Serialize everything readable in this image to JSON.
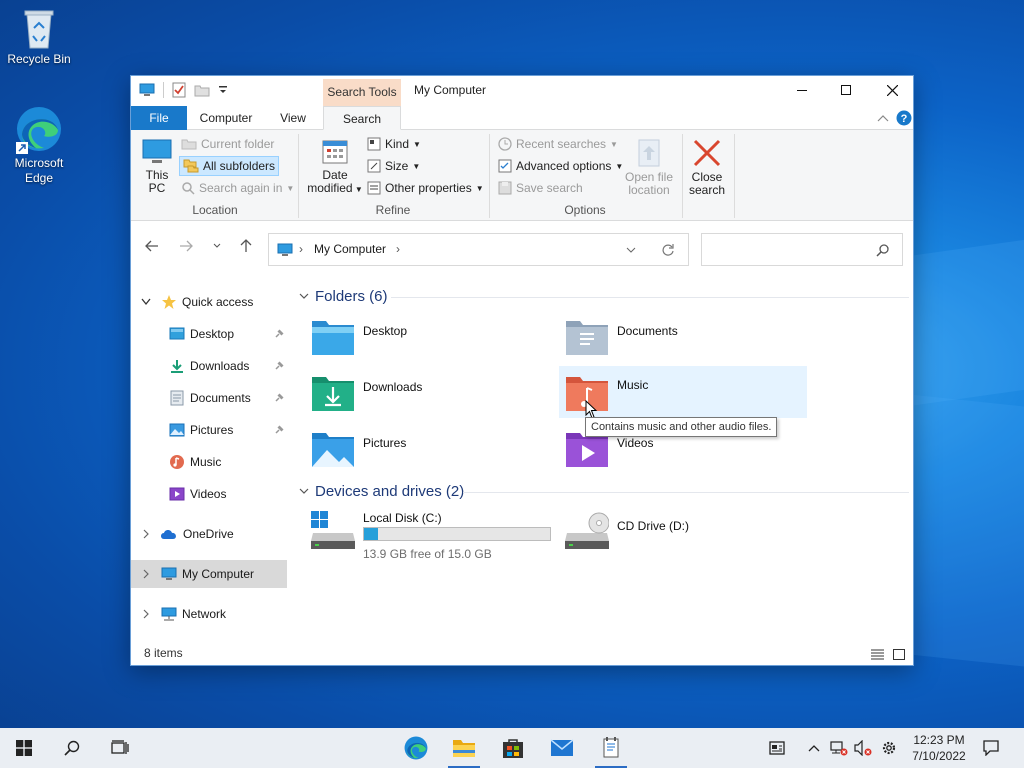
{
  "desktop": {
    "icons": [
      {
        "label": "Recycle Bin",
        "icon": "recycle-bin-icon"
      },
      {
        "label": "Microsoft Edge",
        "icon": "edge-icon"
      }
    ]
  },
  "window": {
    "title": "My Computer",
    "context_tab": "Search Tools",
    "tabs": [
      "File",
      "Computer",
      "View",
      "Search"
    ],
    "active_tab": "Search",
    "ribbon": {
      "location": {
        "label": "Location",
        "this_pc_1": "This",
        "this_pc_2": "PC",
        "current_folder": "Current folder",
        "all_subfolders": "All subfolders",
        "search_again_in": "Search again in"
      },
      "refine": {
        "label": "Refine",
        "date_modified_1": "Date",
        "date_modified_2": "modified",
        "kind": "Kind",
        "size": "Size",
        "other_properties": "Other properties"
      },
      "options": {
        "label": "Options",
        "recent_searches": "Recent searches",
        "advanced_options": "Advanced options",
        "save_search": "Save search",
        "open_file_location_1": "Open file",
        "open_file_location_2": "location"
      },
      "close": {
        "label_1": "Close",
        "label_2": "search"
      }
    },
    "address": {
      "path": "My Computer"
    },
    "search": {
      "placeholder": ""
    },
    "nav": {
      "quick_access": "Quick access",
      "items": [
        "Desktop",
        "Downloads",
        "Documents",
        "Pictures",
        "Music",
        "Videos"
      ],
      "onedrive": "OneDrive",
      "my_computer": "My Computer",
      "network": "Network"
    },
    "content": {
      "folders_header": "Folders (6)",
      "folders": [
        "Desktop",
        "Documents",
        "Downloads",
        "Music",
        "Pictures",
        "Videos"
      ],
      "drives_header": "Devices and drives (2)",
      "local_disk": {
        "name": "Local Disk (C:)",
        "free_text": "13.9 GB free of 15.0 GB",
        "used_fraction": 0.073
      },
      "cd_drive": {
        "name": "CD Drive (D:)"
      },
      "tooltip": "Contains music and other audio files."
    },
    "status": {
      "items": "8 items"
    }
  },
  "taskbar": {
    "time": "12:23 PM",
    "date": "7/10/2022"
  },
  "colors": {
    "accent": "#1979ca",
    "context_tab": "#f9dcc8",
    "drive_fill": "#26a0da"
  }
}
